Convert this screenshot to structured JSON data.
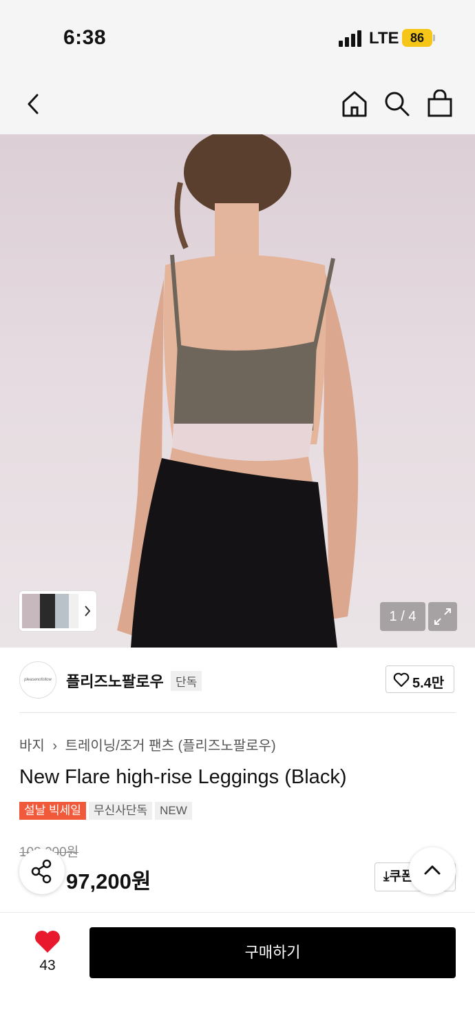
{
  "status_bar": {
    "time": "6:38",
    "carrier": "LTE",
    "battery": "86",
    "battery_color": "#f5c518"
  },
  "nav": {
    "icons": [
      "back-arrow-icon",
      "home-icon",
      "search-icon",
      "shopping-bag-icon"
    ]
  },
  "gallery": {
    "counter": "1 / 4",
    "expand_icon": "expand-icon"
  },
  "brand": {
    "logo_text": "pleasenofollow",
    "name": "플리즈노팔로우",
    "badge": "단독",
    "likes": "5.4만"
  },
  "product": {
    "breadcrumb": [
      "바지",
      "트레이닝/조거 팬츠 (플리즈노팔로우)"
    ],
    "title": "New Flare high-rise Leggings (Black)",
    "tags": [
      "설날 빅세일",
      "무신사단독",
      "NEW"
    ],
    "sale_tag_color": "#f05a3a",
    "original_price": "108,000원",
    "price": "97,200원",
    "coupon_label": "쿠폰"
  },
  "bottom_bar": {
    "wish_count": "43",
    "wish_color": "#e8192c",
    "buy_label": "구매하기"
  }
}
